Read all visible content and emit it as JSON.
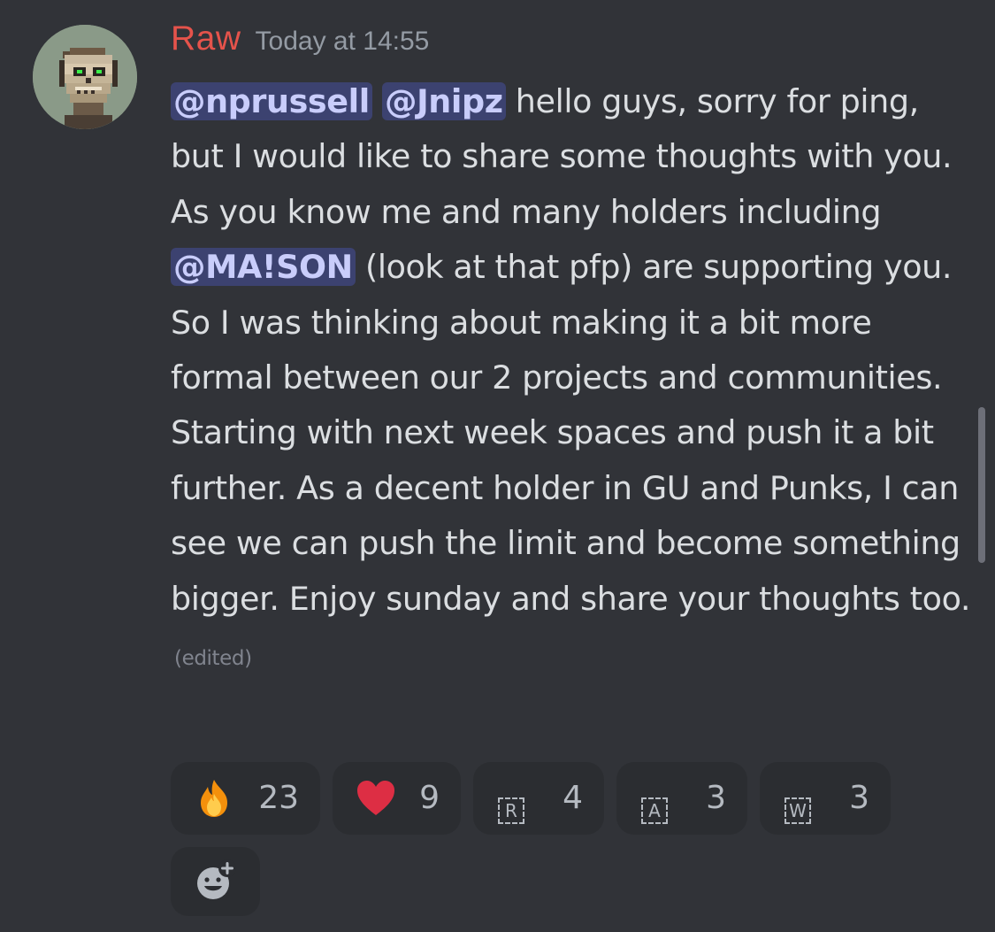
{
  "message": {
    "author": "Raw",
    "timestamp": "Today at 14:55",
    "mentions": [
      "@nprussell",
      "@Jnipz",
      "@MA!SON"
    ],
    "text_parts": [
      " hello guys, sorry for ping, but I would like to share some thoughts with you. As you know me and many holders including ",
      " (look at that pfp) are supporting you. So I was thinking about making it a bit more formal between our 2 projects and communities. Starting with next week spaces and push it a bit further. As a decent holder in GU and Punks, I can see we can push the limit and become something bigger. Enjoy sunday and share your thoughts too. "
    ],
    "edited_label": "(edited)"
  },
  "reactions": [
    {
      "emoji": "fire-emoji",
      "count": "23"
    },
    {
      "emoji": "red-heart-emoji",
      "count": "9"
    },
    {
      "emoji": "letter-r-emoji",
      "letter": "R",
      "count": "4"
    },
    {
      "emoji": "letter-a-emoji",
      "letter": "A",
      "count": "3"
    },
    {
      "emoji": "letter-w-emoji",
      "letter": "W",
      "count": "3"
    }
  ],
  "colors": {
    "background": "#313338",
    "author": "#e5534b",
    "mention_bg": "#3c4270",
    "mention_text": "#c9cdfb",
    "reaction_bg": "#2b2d31"
  }
}
